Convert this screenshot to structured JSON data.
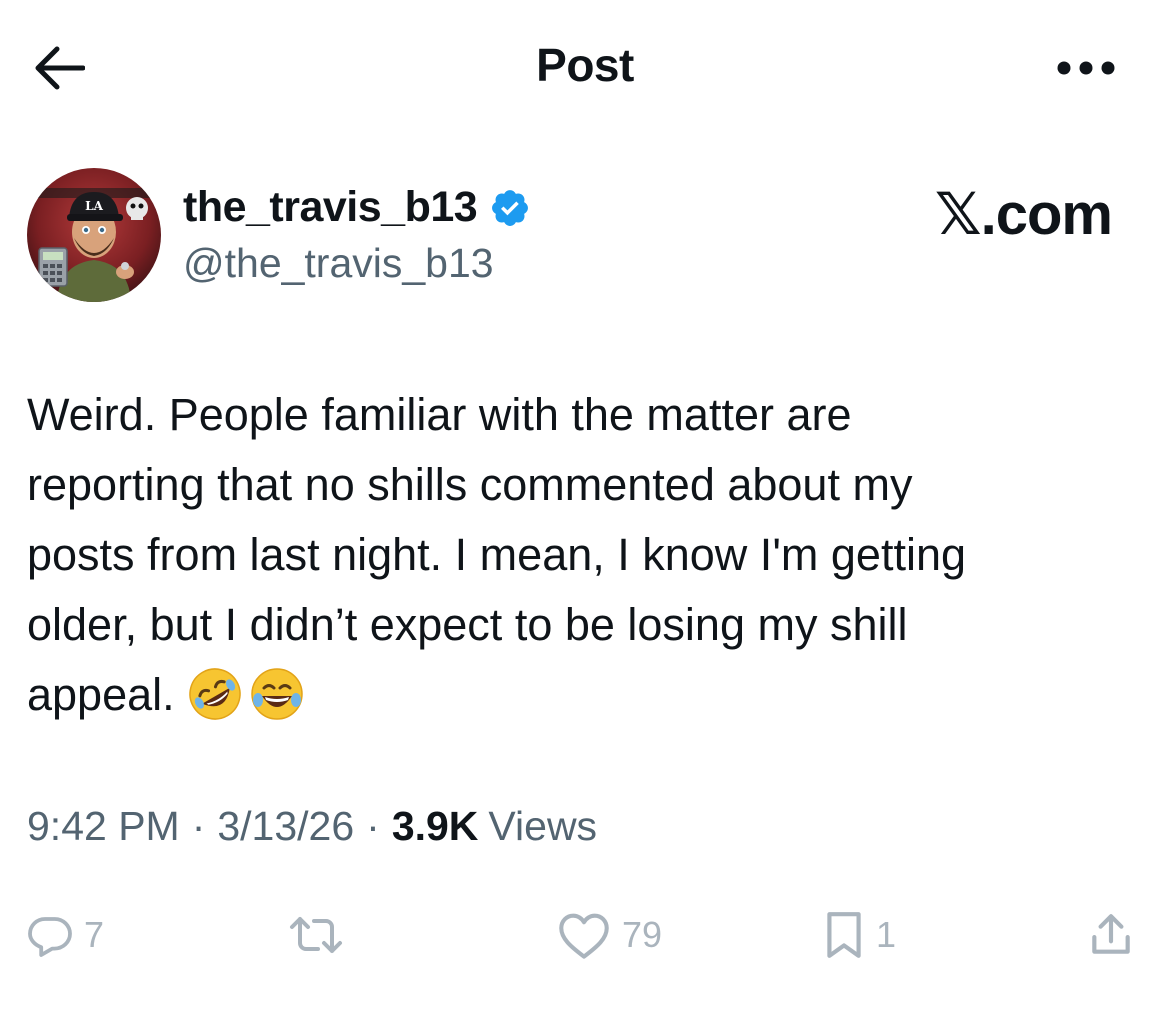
{
  "header": {
    "title": "Post"
  },
  "author": {
    "display_name": "the_travis_b13",
    "handle": "@the_travis_b13",
    "verified": true
  },
  "brand": {
    "logo_text": ".com",
    "logo_mark": "𝕏"
  },
  "post": {
    "text": "Weird. People familiar with the matter are\nreporting that no shills commented about my\nposts from last night. I mean, I know I'm getting\nolder, but I didn’t expect to be losing my shill\nappeal. ",
    "emojis": [
      "rolling-on-floor-laughing-emoji",
      "tears-of-joy-emoji"
    ]
  },
  "meta": {
    "time": "9:42 PM",
    "separator": "·",
    "date": "3/13/26",
    "views_count": "3.9K",
    "views_label": "Views"
  },
  "actions": {
    "replies": "7",
    "reposts": "",
    "likes": "79",
    "bookmarks": "1"
  },
  "colors": {
    "text": "#0f1419",
    "secondary": "#536471",
    "verified": "#1d9bf0",
    "action_icons": "#aab4bd"
  }
}
